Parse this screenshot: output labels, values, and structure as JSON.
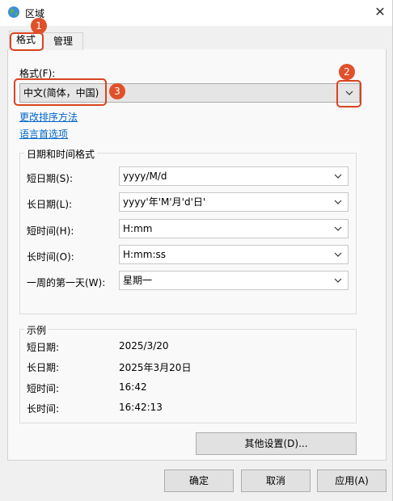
{
  "window": {
    "title": "区域",
    "close_label": "✕"
  },
  "tabs": [
    {
      "label": "格式"
    },
    {
      "label": "管理"
    }
  ],
  "format": {
    "label": "格式(F):",
    "label_key": "F",
    "selected": "中文(简体，中国)"
  },
  "links": {
    "change_sort": "更改排序方法",
    "language_pref": "语言首选项"
  },
  "datetime": {
    "group_title": "日期和时间格式",
    "rows": [
      {
        "label": "短日期(S):",
        "value": "yyyy/M/d"
      },
      {
        "label": "长日期(L):",
        "value": "yyyy'年'M'月'd'日'"
      },
      {
        "label": "短时间(H):",
        "value": "H:mm"
      },
      {
        "label": "长时间(O):",
        "value": "H:mm:ss"
      },
      {
        "label": "一周的第一天(W):",
        "value": "星期一"
      }
    ]
  },
  "examples": {
    "group_title": "示例",
    "rows": [
      {
        "label": "短日期:",
        "value": "2025/3/20"
      },
      {
        "label": "长日期:",
        "value": "2025年3月20日"
      },
      {
        "label": "短时间:",
        "value": "16:42"
      },
      {
        "label": "长时间:",
        "value": "16:42:13"
      }
    ]
  },
  "buttons": {
    "other_settings": "其他设置(D)...",
    "ok": "确定",
    "cancel": "取消",
    "apply": "应用(A)"
  },
  "annotations": [
    {
      "number": "1"
    },
    {
      "number": "2"
    },
    {
      "number": "3"
    }
  ],
  "colors": {
    "annotation_red": "#d9441f",
    "link_blue": "#0066cc"
  }
}
